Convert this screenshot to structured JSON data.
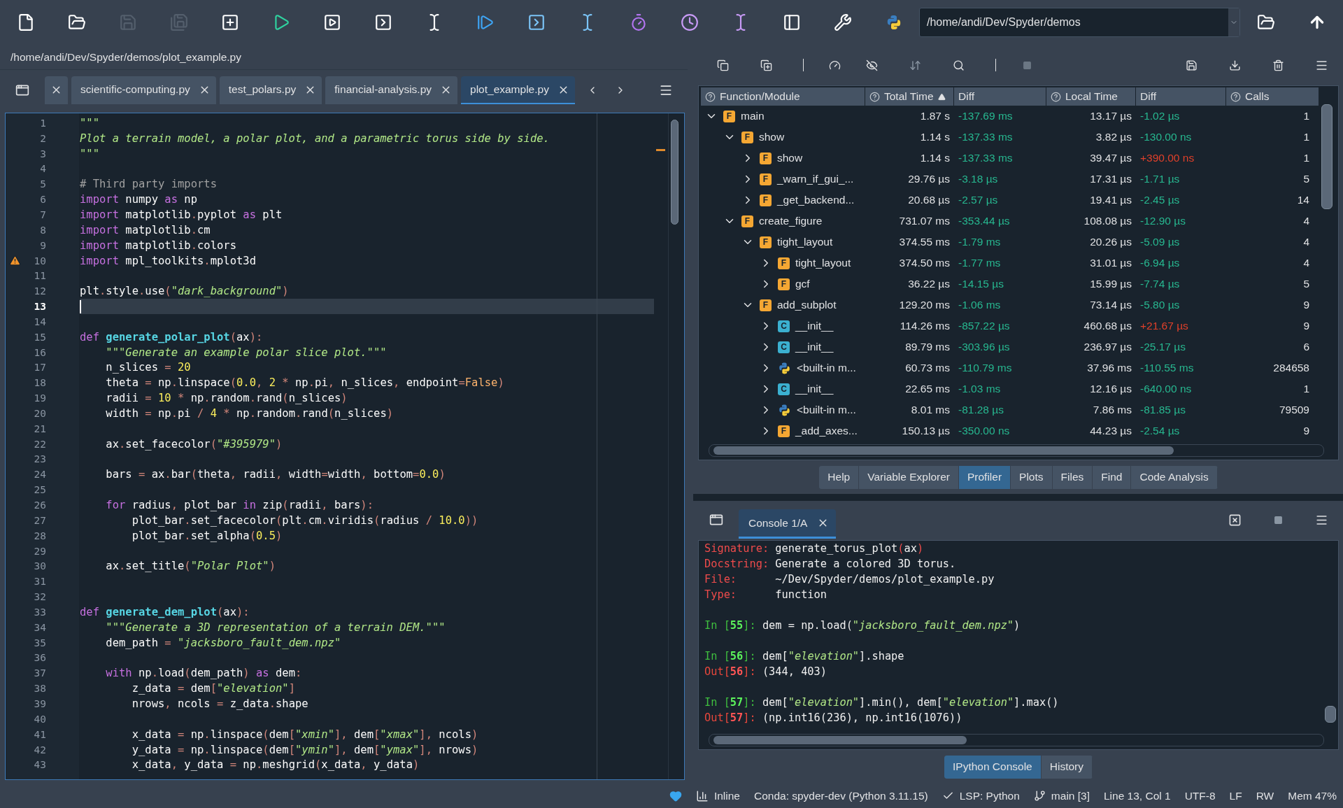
{
  "toolbar": {
    "buttons": [
      {
        "disabled": false
      },
      {
        "disabled": false
      },
      {
        "disabled": true
      },
      {
        "disabled": true
      },
      {
        "disabled": false
      },
      {
        "disabled": false
      },
      {
        "disabled": false
      },
      {
        "disabled": false
      },
      {
        "disabled": false
      },
      {
        "disabled": false
      },
      {
        "disabled": false
      },
      {
        "disabled": false
      },
      {
        "disabled": false
      },
      {
        "disabled": false
      },
      {
        "disabled": false
      },
      {
        "disabled": false
      },
      {
        "disabled": false
      },
      {
        "disabled": false
      }
    ],
    "path": "/home/andi/Dev/Spyder/demos"
  },
  "editor": {
    "file_path": "/home/andi/Dev/Spyder/demos/plot_example.py",
    "tabs": [
      {
        "label": "scientific-computing.py",
        "selected": false
      },
      {
        "label": "test_polars.py",
        "selected": false
      },
      {
        "label": "financial-analysis.py",
        "selected": false
      },
      {
        "label": "plot_example.py",
        "selected": true
      }
    ],
    "lines": [
      {
        "n": "1",
        "current": false,
        "warning": false,
        "tokens": [
          {
            "kind": "doc",
            "text": "\"\"\""
          }
        ]
      },
      {
        "n": "2",
        "current": false,
        "warning": false,
        "tokens": [
          {
            "kind": "doc",
            "text": "Plot a terrain model, a polar plot, and a parametric torus side by side."
          }
        ]
      },
      {
        "n": "3",
        "current": false,
        "warning": false,
        "tokens": [
          {
            "kind": "doc",
            "text": "\"\"\""
          }
        ]
      },
      {
        "n": "4",
        "current": false,
        "warning": false
      },
      {
        "n": "5",
        "current": false,
        "warning": false,
        "tokens": [
          {
            "kind": "com",
            "text": "# Third party imports"
          }
        ]
      },
      {
        "n": "6",
        "current": false,
        "warning": false,
        "tokens": [
          {
            "kind": "kw",
            "text": "import"
          },
          {
            "kind": "p",
            "text": " numpy "
          },
          {
            "kind": "kw",
            "text": "as"
          },
          {
            "kind": "p",
            "text": " np"
          }
        ]
      },
      {
        "n": "7",
        "current": false,
        "warning": false,
        "tokens": [
          {
            "kind": "kw",
            "text": "import"
          },
          {
            "kind": "p",
            "text": " matplotlib"
          },
          {
            "kind": "op",
            "text": "."
          },
          {
            "kind": "p",
            "text": "pyplot "
          },
          {
            "kind": "kw",
            "text": "as"
          },
          {
            "kind": "p",
            "text": " plt"
          }
        ]
      },
      {
        "n": "8",
        "current": false,
        "warning": false,
        "tokens": [
          {
            "kind": "kw",
            "text": "import"
          },
          {
            "kind": "p",
            "text": " matplotlib"
          },
          {
            "kind": "op",
            "text": "."
          },
          {
            "kind": "p",
            "text": "cm"
          }
        ]
      },
      {
        "n": "9",
        "current": false,
        "warning": false,
        "tokens": [
          {
            "kind": "kw",
            "text": "import"
          },
          {
            "kind": "p",
            "text": " matplotlib"
          },
          {
            "kind": "op",
            "text": "."
          },
          {
            "kind": "p",
            "text": "colors"
          }
        ]
      },
      {
        "n": "10",
        "current": false,
        "warning": true,
        "tokens": [
          {
            "kind": "kw",
            "text": "import"
          },
          {
            "kind": "p",
            "text": " mpl_toolkits"
          },
          {
            "kind": "op",
            "text": "."
          },
          {
            "kind": "p",
            "text": "mplot3d"
          }
        ]
      },
      {
        "n": "11",
        "current": false,
        "warning": false
      },
      {
        "n": "12",
        "current": false,
        "warning": false,
        "tokens": [
          {
            "kind": "p",
            "text": "plt"
          },
          {
            "kind": "op",
            "text": "."
          },
          {
            "kind": "p",
            "text": "style"
          },
          {
            "kind": "op",
            "text": "."
          },
          {
            "kind": "p",
            "text": "use"
          },
          {
            "kind": "op",
            "text": "("
          },
          {
            "kind": "str",
            "text": "\"dark_background\""
          },
          {
            "kind": "op",
            "text": ")"
          }
        ]
      },
      {
        "n": "13",
        "current": true,
        "warning": false
      },
      {
        "n": "14",
        "current": false,
        "warning": false
      },
      {
        "n": "15",
        "current": false,
        "warning": false,
        "tokens": [
          {
            "kind": "kw",
            "text": "def "
          },
          {
            "kind": "def",
            "text": "generate_polar_plot"
          },
          {
            "kind": "op",
            "text": "("
          },
          {
            "kind": "p",
            "text": "ax"
          },
          {
            "kind": "op",
            "text": "):"
          }
        ]
      },
      {
        "n": "16",
        "current": false,
        "warning": false,
        "tokens": [
          {
            "kind": "doc",
            "text": "    \"\"\"Generate an example polar slice plot.\"\"\""
          }
        ]
      },
      {
        "n": "17",
        "current": false,
        "warning": false,
        "tokens": [
          {
            "kind": "p",
            "text": "    n_slices "
          },
          {
            "kind": "op",
            "text": "="
          },
          {
            "kind": "num",
            "text": " 20"
          }
        ]
      },
      {
        "n": "18",
        "current": false,
        "warning": false,
        "tokens": [
          {
            "kind": "p",
            "text": "    theta "
          },
          {
            "kind": "op",
            "text": "="
          },
          {
            "kind": "p",
            "text": " np"
          },
          {
            "kind": "op",
            "text": "."
          },
          {
            "kind": "p",
            "text": "linspace"
          },
          {
            "kind": "op",
            "text": "("
          },
          {
            "kind": "num",
            "text": "0.0"
          },
          {
            "kind": "op",
            "text": ","
          },
          {
            "kind": "num",
            "text": " 2"
          },
          {
            "kind": "op",
            "text": " * "
          },
          {
            "kind": "p",
            "text": "np"
          },
          {
            "kind": "op",
            "text": "."
          },
          {
            "kind": "p",
            "text": "pi"
          },
          {
            "kind": "op",
            "text": ","
          },
          {
            "kind": "p",
            "text": " n_slices"
          },
          {
            "kind": "op",
            "text": ","
          },
          {
            "kind": "p",
            "text": " endpoint"
          },
          {
            "kind": "op",
            "text": "="
          },
          {
            "kind": "bi",
            "text": "False"
          },
          {
            "kind": "op",
            "text": ")"
          }
        ]
      },
      {
        "n": "19",
        "current": false,
        "warning": false,
        "tokens": [
          {
            "kind": "p",
            "text": "    radii "
          },
          {
            "kind": "op",
            "text": "="
          },
          {
            "kind": "num",
            "text": " 10"
          },
          {
            "kind": "op",
            "text": " * "
          },
          {
            "kind": "p",
            "text": "np"
          },
          {
            "kind": "op",
            "text": "."
          },
          {
            "kind": "p",
            "text": "random"
          },
          {
            "kind": "op",
            "text": "."
          },
          {
            "kind": "p",
            "text": "rand"
          },
          {
            "kind": "op",
            "text": "("
          },
          {
            "kind": "p",
            "text": "n_slices"
          },
          {
            "kind": "op",
            "text": ")"
          }
        ]
      },
      {
        "n": "20",
        "current": false,
        "warning": false,
        "tokens": [
          {
            "kind": "p",
            "text": "    width "
          },
          {
            "kind": "op",
            "text": "="
          },
          {
            "kind": "p",
            "text": " np"
          },
          {
            "kind": "op",
            "text": "."
          },
          {
            "kind": "p",
            "text": "pi "
          },
          {
            "kind": "op",
            "text": "/"
          },
          {
            "kind": "num",
            "text": " 4"
          },
          {
            "kind": "op",
            "text": " * "
          },
          {
            "kind": "p",
            "text": "np"
          },
          {
            "kind": "op",
            "text": "."
          },
          {
            "kind": "p",
            "text": "random"
          },
          {
            "kind": "op",
            "text": "."
          },
          {
            "kind": "p",
            "text": "rand"
          },
          {
            "kind": "op",
            "text": "("
          },
          {
            "kind": "p",
            "text": "n_slices"
          },
          {
            "kind": "op",
            "text": ")"
          }
        ]
      },
      {
        "n": "21",
        "current": false,
        "warning": false
      },
      {
        "n": "22",
        "current": false,
        "warning": false,
        "tokens": [
          {
            "kind": "p",
            "text": "    ax"
          },
          {
            "kind": "op",
            "text": "."
          },
          {
            "kind": "p",
            "text": "set_facecolor"
          },
          {
            "kind": "op",
            "text": "("
          },
          {
            "kind": "str",
            "text": "\"#395979\""
          },
          {
            "kind": "op",
            "text": ")"
          }
        ]
      },
      {
        "n": "23",
        "current": false,
        "warning": false
      },
      {
        "n": "24",
        "current": false,
        "warning": false,
        "tokens": [
          {
            "kind": "p",
            "text": "    bars "
          },
          {
            "kind": "op",
            "text": "="
          },
          {
            "kind": "p",
            "text": " ax"
          },
          {
            "kind": "op",
            "text": "."
          },
          {
            "kind": "p",
            "text": "bar"
          },
          {
            "kind": "op",
            "text": "("
          },
          {
            "kind": "p",
            "text": "theta"
          },
          {
            "kind": "op",
            "text": ","
          },
          {
            "kind": "p",
            "text": " radii"
          },
          {
            "kind": "op",
            "text": ","
          },
          {
            "kind": "p",
            "text": " width"
          },
          {
            "kind": "op",
            "text": "="
          },
          {
            "kind": "p",
            "text": "width"
          },
          {
            "kind": "op",
            "text": ","
          },
          {
            "kind": "p",
            "text": " bottom"
          },
          {
            "kind": "op",
            "text": "="
          },
          {
            "kind": "num",
            "text": "0.0"
          },
          {
            "kind": "op",
            "text": ")"
          }
        ]
      },
      {
        "n": "25",
        "current": false,
        "warning": false
      },
      {
        "n": "26",
        "current": false,
        "warning": false,
        "tokens": [
          {
            "kind": "kw",
            "text": "    for"
          },
          {
            "kind": "p",
            "text": " radius"
          },
          {
            "kind": "op",
            "text": ","
          },
          {
            "kind": "p",
            "text": " plot_bar "
          },
          {
            "kind": "kw",
            "text": "in"
          },
          {
            "kind": "p",
            "text": " zip"
          },
          {
            "kind": "op",
            "text": "("
          },
          {
            "kind": "p",
            "text": "radii"
          },
          {
            "kind": "op",
            "text": ","
          },
          {
            "kind": "p",
            "text": " bars"
          },
          {
            "kind": "op",
            "text": "):"
          }
        ]
      },
      {
        "n": "27",
        "current": false,
        "warning": false,
        "tokens": [
          {
            "kind": "p",
            "text": "        plot_bar"
          },
          {
            "kind": "op",
            "text": "."
          },
          {
            "kind": "p",
            "text": "set_facecolor"
          },
          {
            "kind": "op",
            "text": "("
          },
          {
            "kind": "p",
            "text": "plt"
          },
          {
            "kind": "op",
            "text": "."
          },
          {
            "kind": "p",
            "text": "cm"
          },
          {
            "kind": "op",
            "text": "."
          },
          {
            "kind": "p",
            "text": "viridis"
          },
          {
            "kind": "op",
            "text": "("
          },
          {
            "kind": "p",
            "text": "radius "
          },
          {
            "kind": "op",
            "text": "/"
          },
          {
            "kind": "num",
            "text": " 10.0"
          },
          {
            "kind": "op",
            "text": "))"
          }
        ]
      },
      {
        "n": "28",
        "current": false,
        "warning": false,
        "tokens": [
          {
            "kind": "p",
            "text": "        plot_bar"
          },
          {
            "kind": "op",
            "text": "."
          },
          {
            "kind": "p",
            "text": "set_alpha"
          },
          {
            "kind": "op",
            "text": "("
          },
          {
            "kind": "num",
            "text": "0.5"
          },
          {
            "kind": "op",
            "text": ")"
          }
        ]
      },
      {
        "n": "29",
        "current": false,
        "warning": false
      },
      {
        "n": "30",
        "current": false,
        "warning": false,
        "tokens": [
          {
            "kind": "p",
            "text": "    ax"
          },
          {
            "kind": "op",
            "text": "."
          },
          {
            "kind": "p",
            "text": "set_title"
          },
          {
            "kind": "op",
            "text": "("
          },
          {
            "kind": "str",
            "text": "\"Polar Plot\""
          },
          {
            "kind": "op",
            "text": ")"
          }
        ]
      },
      {
        "n": "31",
        "current": false,
        "warning": false
      },
      {
        "n": "32",
        "current": false,
        "warning": false
      },
      {
        "n": "33",
        "current": false,
        "warning": false,
        "tokens": [
          {
            "kind": "kw",
            "text": "def "
          },
          {
            "kind": "def",
            "text": "generate_dem_plot"
          },
          {
            "kind": "op",
            "text": "("
          },
          {
            "kind": "p",
            "text": "ax"
          },
          {
            "kind": "op",
            "text": "):"
          }
        ]
      },
      {
        "n": "34",
        "current": false,
        "warning": false,
        "tokens": [
          {
            "kind": "doc",
            "text": "    \"\"\"Generate a 3D representation of a terrain DEM.\"\"\""
          }
        ]
      },
      {
        "n": "35",
        "current": false,
        "warning": false,
        "tokens": [
          {
            "kind": "p",
            "text": "    dem_path "
          },
          {
            "kind": "op",
            "text": "="
          },
          {
            "kind": "str",
            "text": " \"jacksboro_fault_dem.npz\""
          }
        ]
      },
      {
        "n": "36",
        "current": false,
        "warning": false
      },
      {
        "n": "37",
        "current": false,
        "warning": false,
        "tokens": [
          {
            "kind": "kw",
            "text": "    with"
          },
          {
            "kind": "p",
            "text": " np"
          },
          {
            "kind": "op",
            "text": "."
          },
          {
            "kind": "p",
            "text": "load"
          },
          {
            "kind": "op",
            "text": "("
          },
          {
            "kind": "p",
            "text": "dem_path"
          },
          {
            "kind": "op",
            "text": ")"
          },
          {
            "kind": "kw",
            "text": " as"
          },
          {
            "kind": "p",
            "text": " dem"
          },
          {
            "kind": "op",
            "text": ":"
          }
        ]
      },
      {
        "n": "38",
        "current": false,
        "warning": false,
        "tokens": [
          {
            "kind": "p",
            "text": "        z_data "
          },
          {
            "kind": "op",
            "text": "="
          },
          {
            "kind": "p",
            "text": " dem"
          },
          {
            "kind": "op",
            "text": "["
          },
          {
            "kind": "str",
            "text": "\"elevation\""
          },
          {
            "kind": "op",
            "text": "]"
          }
        ]
      },
      {
        "n": "39",
        "current": false,
        "warning": false,
        "tokens": [
          {
            "kind": "p",
            "text": "        nrows"
          },
          {
            "kind": "op",
            "text": ","
          },
          {
            "kind": "p",
            "text": " ncols "
          },
          {
            "kind": "op",
            "text": "="
          },
          {
            "kind": "p",
            "text": " z_data"
          },
          {
            "kind": "op",
            "text": "."
          },
          {
            "kind": "p",
            "text": "shape"
          }
        ]
      },
      {
        "n": "40",
        "current": false,
        "warning": false
      },
      {
        "n": "41",
        "current": false,
        "warning": false,
        "tokens": [
          {
            "kind": "p",
            "text": "        x_data "
          },
          {
            "kind": "op",
            "text": "="
          },
          {
            "kind": "p",
            "text": " np"
          },
          {
            "kind": "op",
            "text": "."
          },
          {
            "kind": "p",
            "text": "linspace"
          },
          {
            "kind": "op",
            "text": "("
          },
          {
            "kind": "p",
            "text": "dem"
          },
          {
            "kind": "op",
            "text": "["
          },
          {
            "kind": "str",
            "text": "\"xmin\""
          },
          {
            "kind": "op",
            "text": "],"
          },
          {
            "kind": "p",
            "text": " dem"
          },
          {
            "kind": "op",
            "text": "["
          },
          {
            "kind": "str",
            "text": "\"xmax\""
          },
          {
            "kind": "op",
            "text": "],"
          },
          {
            "kind": "p",
            "text": " ncols"
          },
          {
            "kind": "op",
            "text": ")"
          }
        ]
      },
      {
        "n": "42",
        "current": false,
        "warning": false,
        "tokens": [
          {
            "kind": "p",
            "text": "        y_data "
          },
          {
            "kind": "op",
            "text": "="
          },
          {
            "kind": "p",
            "text": " np"
          },
          {
            "kind": "op",
            "text": "."
          },
          {
            "kind": "p",
            "text": "linspace"
          },
          {
            "kind": "op",
            "text": "("
          },
          {
            "kind": "p",
            "text": "dem"
          },
          {
            "kind": "op",
            "text": "["
          },
          {
            "kind": "str",
            "text": "\"ymin\""
          },
          {
            "kind": "op",
            "text": "],"
          },
          {
            "kind": "p",
            "text": " dem"
          },
          {
            "kind": "op",
            "text": "["
          },
          {
            "kind": "str",
            "text": "\"ymax\""
          },
          {
            "kind": "op",
            "text": "],"
          },
          {
            "kind": "p",
            "text": " nrows"
          },
          {
            "kind": "op",
            "text": ")"
          }
        ]
      },
      {
        "n": "43",
        "current": false,
        "warning": false,
        "tokens": [
          {
            "kind": "p",
            "text": "        x_data"
          },
          {
            "kind": "op",
            "text": ","
          },
          {
            "kind": "p",
            "text": " y_data "
          },
          {
            "kind": "op",
            "text": "="
          },
          {
            "kind": "p",
            "text": " np"
          },
          {
            "kind": "op",
            "text": "."
          },
          {
            "kind": "p",
            "text": "meshgrid"
          },
          {
            "kind": "op",
            "text": "("
          },
          {
            "kind": "p",
            "text": "x_data"
          },
          {
            "kind": "op",
            "text": ","
          },
          {
            "kind": "p",
            "text": " y_data"
          },
          {
            "kind": "op",
            "text": ")"
          }
        ]
      }
    ]
  },
  "profiler": {
    "columns": [
      {
        "label": "Function/Module",
        "help": true,
        "sorted": false
      },
      {
        "label": "Total Time",
        "help": true,
        "sorted": true
      },
      {
        "label": "Diff",
        "help": false,
        "sorted": false
      },
      {
        "label": "Local Time",
        "help": true,
        "sorted": false
      },
      {
        "label": "Diff",
        "help": false,
        "sorted": false
      },
      {
        "label": "Calls",
        "help": true,
        "sorted": false
      }
    ],
    "rows": [
      {
        "name": "main",
        "kind": "function",
        "badge": "F",
        "expanded": true,
        "total": "1.87 s",
        "total_diff": {
          "text": "-137.69 ms",
          "worse": false
        },
        "local": "13.17 µs",
        "local_diff": {
          "text": "-1.02 µs",
          "worse": false
        },
        "calls": "1",
        "children": [
          {
            "name": "show",
            "kind": "function",
            "badge": "F",
            "expanded": true,
            "total": "1.14 s",
            "total_diff": {
              "text": "-137.33 ms",
              "worse": false
            },
            "local": "3.82 µs",
            "local_diff": {
              "text": "-130.00 ns",
              "worse": false
            },
            "calls": "1",
            "children": [
              {
                "name": "show",
                "kind": "function",
                "badge": "F",
                "expanded": false,
                "total": "1.14 s",
                "total_diff": {
                  "text": "-137.33 ms",
                  "worse": false
                },
                "local": "39.47 µs",
                "local_diff": {
                  "text": "+390.00 ns",
                  "worse": true
                },
                "calls": "1"
              },
              {
                "name": "_warn_if_gui_...",
                "kind": "function",
                "badge": "F",
                "expanded": false,
                "total": "29.76 µs",
                "total_diff": {
                  "text": "-3.18 µs",
                  "worse": false
                },
                "local": "17.31 µs",
                "local_diff": {
                  "text": "-1.71 µs",
                  "worse": false
                },
                "calls": "5"
              },
              {
                "name": "_get_backend...",
                "kind": "function",
                "badge": "F",
                "expanded": false,
                "total": "20.68 µs",
                "total_diff": {
                  "text": "-2.57 µs",
                  "worse": false
                },
                "local": "19.41 µs",
                "local_diff": {
                  "text": "-2.45 µs",
                  "worse": false
                },
                "calls": "14"
              }
            ]
          },
          {
            "name": "create_figure",
            "kind": "function",
            "badge": "F",
            "expanded": true,
            "total": "731.07 ms",
            "total_diff": {
              "text": "-353.44 µs",
              "worse": false
            },
            "local": "108.08 µs",
            "local_diff": {
              "text": "-12.90 µs",
              "worse": false
            },
            "calls": "4",
            "children": [
              {
                "name": "tight_layout",
                "kind": "function",
                "badge": "F",
                "expanded": true,
                "total": "374.55 ms",
                "total_diff": {
                  "text": "-1.79 ms",
                  "worse": false
                },
                "local": "20.26 µs",
                "local_diff": {
                  "text": "-5.09 µs",
                  "worse": false
                },
                "calls": "4",
                "children": [
                  {
                    "name": "tight_layout",
                    "kind": "function",
                    "badge": "F",
                    "expanded": false,
                    "total": "374.50 ms",
                    "total_diff": {
                      "text": "-1.77 ms",
                      "worse": false
                    },
                    "local": "31.01 µs",
                    "local_diff": {
                      "text": "-6.94 µs",
                      "worse": false
                    },
                    "calls": "4"
                  },
                  {
                    "name": "gcf",
                    "kind": "function",
                    "badge": "F",
                    "expanded": false,
                    "total": "36.22 µs",
                    "total_diff": {
                      "text": "-14.15 µs",
                      "worse": false
                    },
                    "local": "15.99 µs",
                    "local_diff": {
                      "text": "-7.74 µs",
                      "worse": false
                    },
                    "calls": "5"
                  }
                ]
              },
              {
                "name": "add_subplot",
                "kind": "function",
                "badge": "F",
                "expanded": true,
                "total": "129.20 ms",
                "total_diff": {
                  "text": "-1.06 ms",
                  "worse": false
                },
                "local": "73.14 µs",
                "local_diff": {
                  "text": "-5.80 µs",
                  "worse": false
                },
                "calls": "9",
                "children": [
                  {
                    "name": "__init__",
                    "kind": "class",
                    "badge": "C",
                    "expanded": false,
                    "total": "114.26 ms",
                    "total_diff": {
                      "text": "-857.22 µs",
                      "worse": false
                    },
                    "local": "460.68 µs",
                    "local_diff": {
                      "text": "+21.67 µs",
                      "worse": true
                    },
                    "calls": "9"
                  },
                  {
                    "name": "__init__",
                    "kind": "class",
                    "badge": "C",
                    "expanded": false,
                    "total": "89.79 ms",
                    "total_diff": {
                      "text": "-303.96 µs",
                      "worse": false
                    },
                    "local": "236.97 µs",
                    "local_diff": {
                      "text": "-25.17 µs",
                      "worse": false
                    },
                    "calls": "6"
                  },
                  {
                    "name": "<built-in m...",
                    "kind": "builtin",
                    "expanded": false,
                    "total": "60.73 ms",
                    "total_diff": {
                      "text": "-110.79 ms",
                      "worse": false
                    },
                    "local": "37.96 ms",
                    "local_diff": {
                      "text": "-110.55 ms",
                      "worse": false
                    },
                    "calls": "284658"
                  },
                  {
                    "name": "__init__",
                    "kind": "class",
                    "badge": "C",
                    "expanded": false,
                    "total": "22.65 ms",
                    "total_diff": {
                      "text": "-1.03 ms",
                      "worse": false
                    },
                    "local": "12.16 µs",
                    "local_diff": {
                      "text": "-640.00 ns",
                      "worse": false
                    },
                    "calls": "1"
                  },
                  {
                    "name": "<built-in m...",
                    "kind": "builtin",
                    "expanded": false,
                    "total": "8.01 ms",
                    "total_diff": {
                      "text": "-81.28 µs",
                      "worse": false
                    },
                    "local": "7.86 ms",
                    "local_diff": {
                      "text": "-81.85 µs",
                      "worse": false
                    },
                    "calls": "79509"
                  },
                  {
                    "name": "_add_axes...",
                    "kind": "function",
                    "badge": "F",
                    "expanded": false,
                    "total": "150.13 µs",
                    "total_diff": {
                      "text": "-350.00 ns",
                      "worse": false
                    },
                    "local": "44.23 µs",
                    "local_diff": {
                      "text": "-2.54 µs",
                      "worse": false
                    },
                    "calls": "9"
                  }
                ]
              }
            ]
          }
        ]
      }
    ],
    "pane_tabs": [
      {
        "label": "Help",
        "selected": false
      },
      {
        "label": "Variable Explorer",
        "selected": false
      },
      {
        "label": "Profiler",
        "selected": true
      },
      {
        "label": "Plots",
        "selected": false
      },
      {
        "label": "Files",
        "selected": false
      },
      {
        "label": "Find",
        "selected": false
      },
      {
        "label": "Code Analysis",
        "selected": false
      }
    ]
  },
  "console": {
    "tabs": [
      {
        "label": "Console 1/A",
        "selected": true
      }
    ],
    "lines": [
      {
        "space_before": false,
        "tokens": [
          {
            "kind": "label",
            "text": "Signature: "
          },
          {
            "kind": "p",
            "text": "generate_torus_plot"
          },
          {
            "kind": "paren",
            "text": "("
          },
          {
            "kind": "p",
            "text": "ax"
          },
          {
            "kind": "paren",
            "text": ")"
          }
        ]
      },
      {
        "space_before": false,
        "tokens": [
          {
            "kind": "label",
            "text": "Docstring: "
          },
          {
            "kind": "p",
            "text": "Generate a colored 3D torus."
          }
        ]
      },
      {
        "space_before": false,
        "tokens": [
          {
            "kind": "label",
            "text": "File:      "
          },
          {
            "kind": "p",
            "text": "~/Dev/Spyder/demos/plot_example.py"
          }
        ]
      },
      {
        "space_before": false,
        "tokens": [
          {
            "kind": "label",
            "text": "Type:      "
          },
          {
            "kind": "p",
            "text": "function"
          }
        ]
      },
      {
        "space_before": true,
        "tokens": [
          {
            "kind": "in",
            "text": "In ["
          },
          {
            "kind": "in_n",
            "text": "55"
          },
          {
            "kind": "in",
            "text": "]: "
          },
          {
            "kind": "p",
            "text": "dem = np.load("
          },
          {
            "kind": "str",
            "text": "\"jacksboro_fault_dem.npz\""
          },
          {
            "kind": "p",
            "text": ")"
          }
        ]
      },
      {
        "space_before": true,
        "tokens": [
          {
            "kind": "in",
            "text": "In ["
          },
          {
            "kind": "in_n",
            "text": "56"
          },
          {
            "kind": "in",
            "text": "]: "
          },
          {
            "kind": "p",
            "text": "dem["
          },
          {
            "kind": "str",
            "text": "\"elevation\""
          },
          {
            "kind": "p",
            "text": "].shape"
          }
        ]
      },
      {
        "space_before": false,
        "tokens": [
          {
            "kind": "out",
            "text": "Out["
          },
          {
            "kind": "out_n",
            "text": "56"
          },
          {
            "kind": "out",
            "text": "]: "
          },
          {
            "kind": "p",
            "text": "(344, 403)"
          }
        ]
      },
      {
        "space_before": true,
        "tokens": [
          {
            "kind": "in",
            "text": "In ["
          },
          {
            "kind": "in_n",
            "text": "57"
          },
          {
            "kind": "in",
            "text": "]: "
          },
          {
            "kind": "p",
            "text": "dem["
          },
          {
            "kind": "str",
            "text": "\"elevation\""
          },
          {
            "kind": "p",
            "text": "].min(), dem["
          },
          {
            "kind": "str",
            "text": "\"elevation\""
          },
          {
            "kind": "p",
            "text": "].max()"
          }
        ]
      },
      {
        "space_before": false,
        "tokens": [
          {
            "kind": "out",
            "text": "Out["
          },
          {
            "kind": "out_n",
            "text": "57"
          },
          {
            "kind": "out",
            "text": "]: "
          },
          {
            "kind": "p",
            "text": "(np.int16(236), np.int16(1076))"
          }
        ]
      }
    ],
    "pane_tabs": [
      {
        "label": "IPython Console",
        "selected": true
      },
      {
        "label": "History",
        "selected": false
      }
    ]
  },
  "status_bar": [
    {
      "kind": "heart"
    },
    {
      "kind": "plots",
      "text": "Inline"
    },
    {
      "kind": "text",
      "text": "Conda: spyder-dev (Python 3.11.15)"
    },
    {
      "kind": "lsp",
      "text": "LSP: Python"
    },
    {
      "kind": "git",
      "text": "main [3]"
    },
    {
      "kind": "text",
      "text": "Line 13, Col 1"
    },
    {
      "kind": "text",
      "text": "UTF-8"
    },
    {
      "kind": "text",
      "text": "LF"
    },
    {
      "kind": "text",
      "text": "RW"
    },
    {
      "kind": "text",
      "text": "Mem 47%"
    }
  ]
}
